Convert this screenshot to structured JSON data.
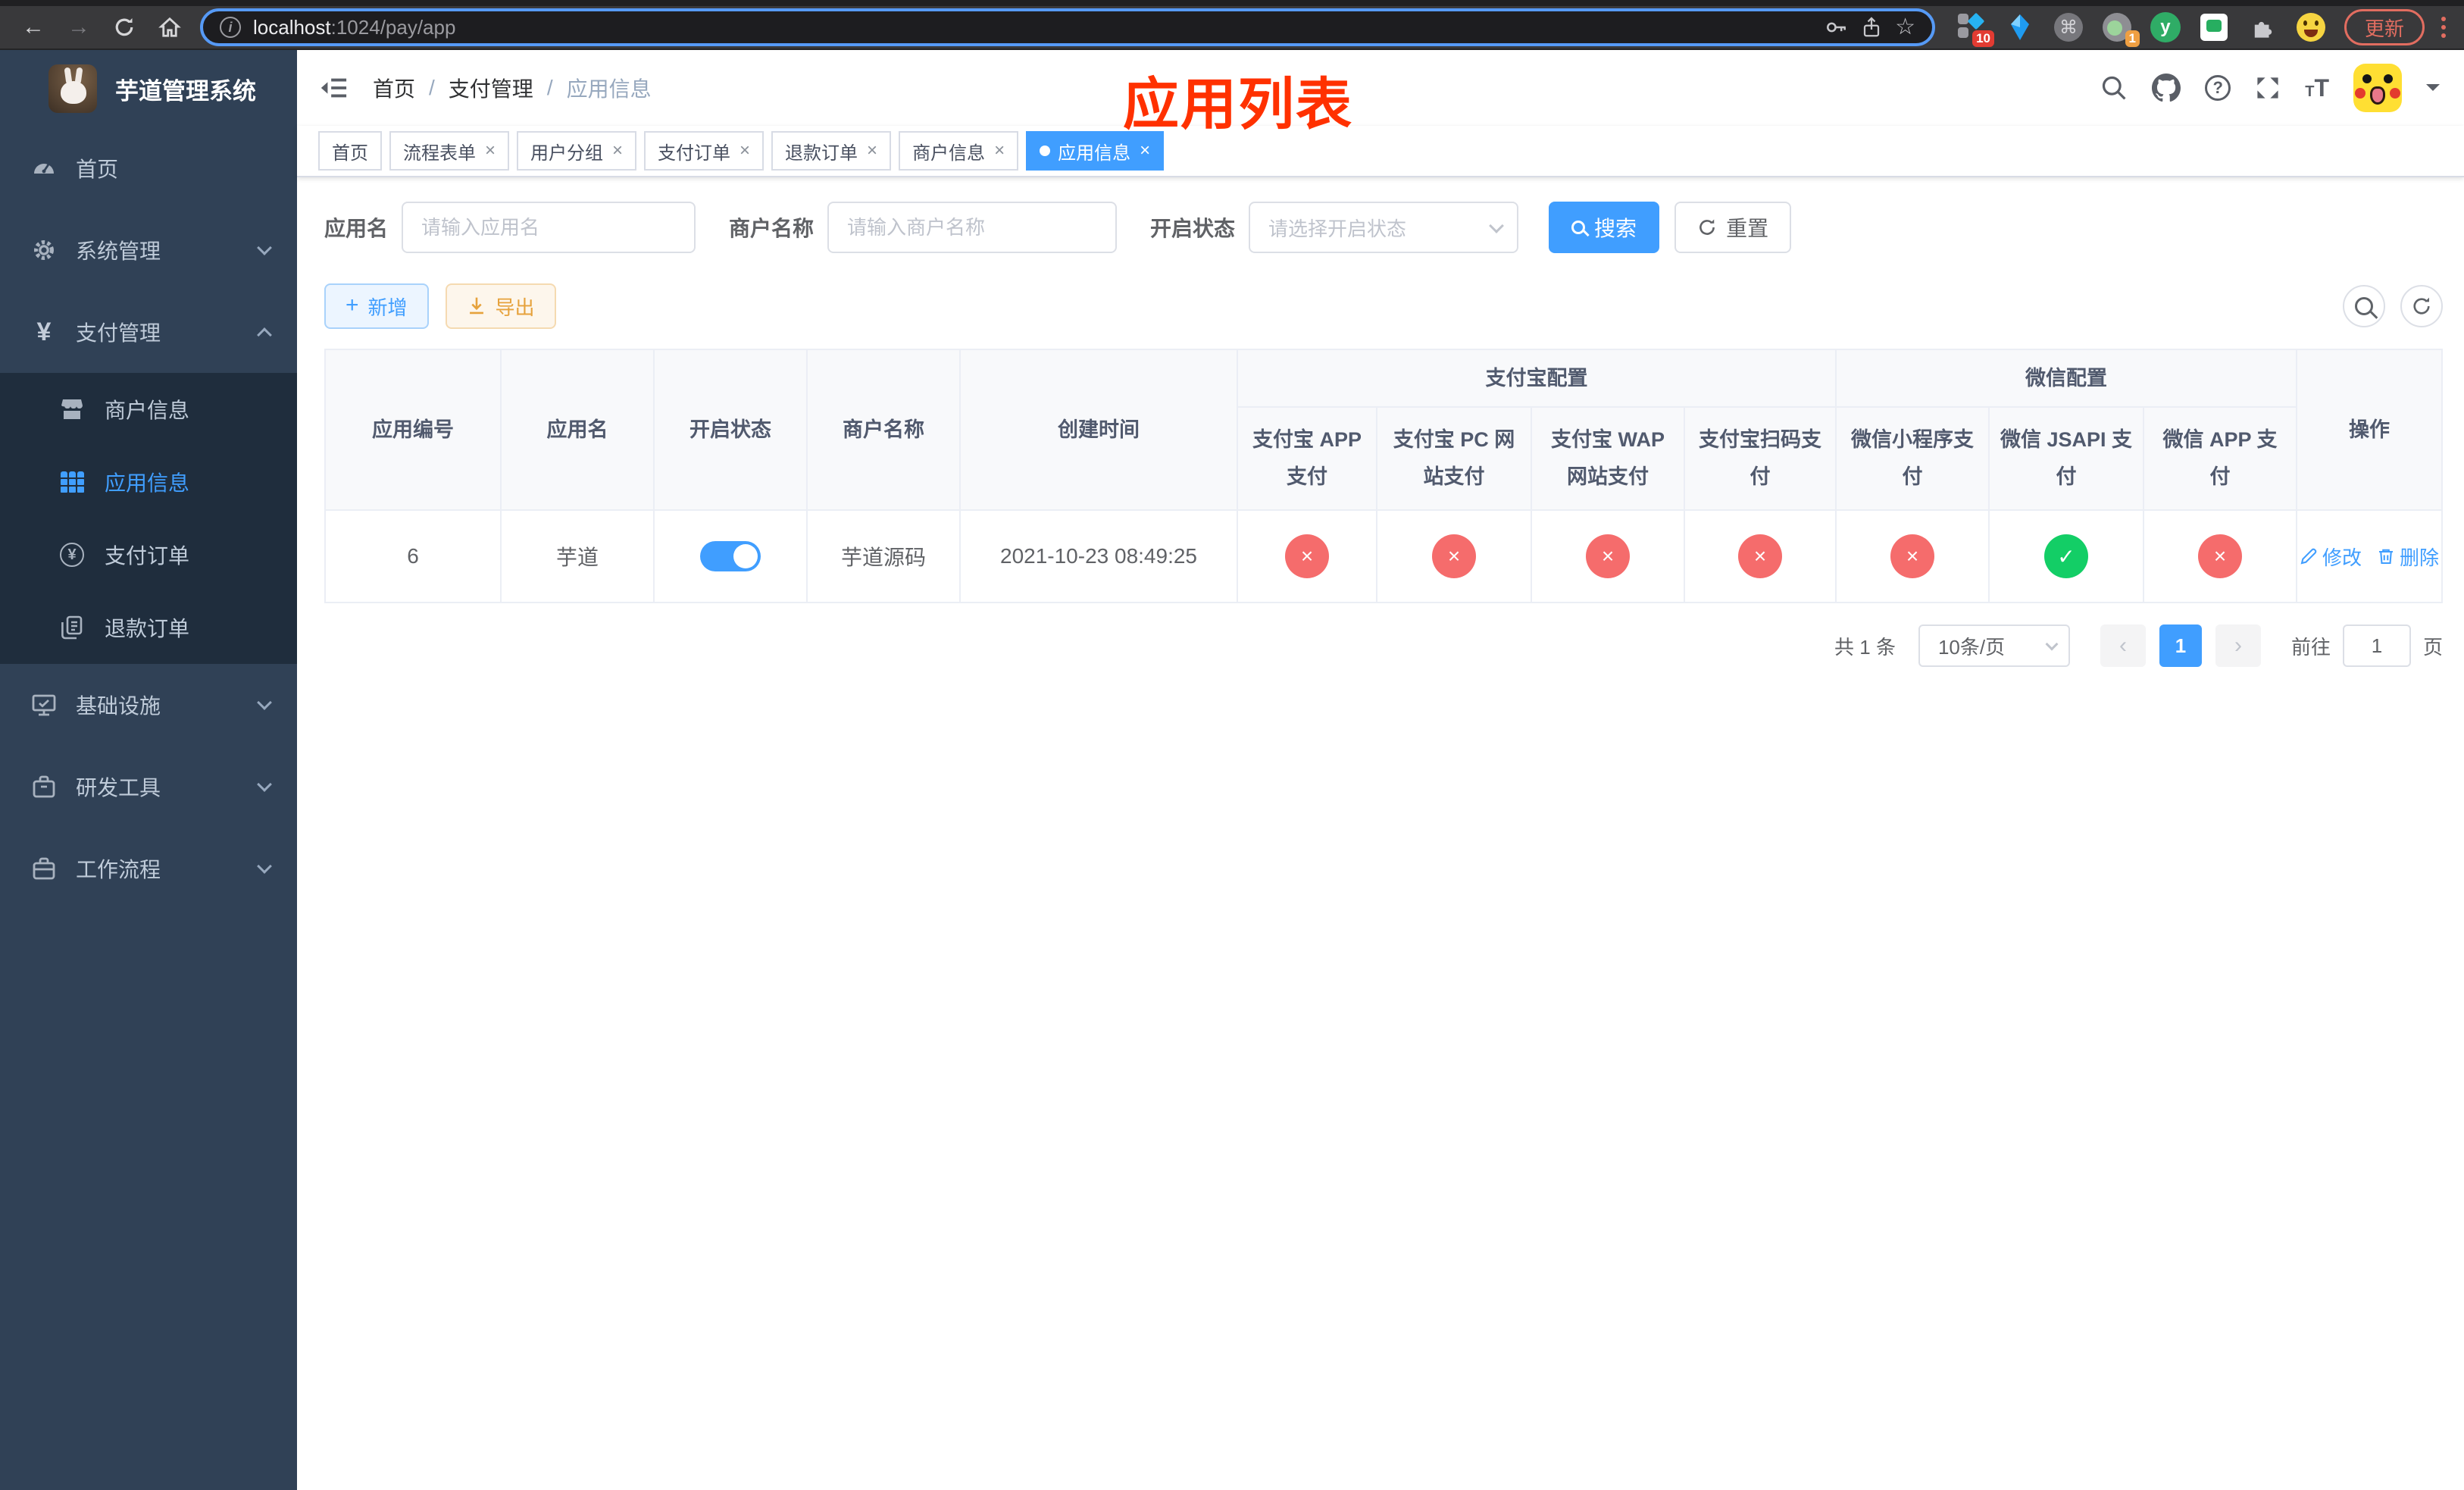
{
  "colors": {
    "accent": "#409EFF",
    "danger": "#F56C6C",
    "success": "#13CE66",
    "warning": "#E6A23C",
    "sidebar_bg": "#304156",
    "submenu_bg": "#1F2D3D",
    "annotation": "#FF3100"
  },
  "browser": {
    "url_host": "localhost",
    "url_rest": ":1024/pay/app",
    "update_label": "更新",
    "ext_blocker_badge": "10",
    "ext_notifier_badge": "1",
    "ext_letter": "y"
  },
  "sidebar": {
    "title": "芋道管理系统",
    "menu": [
      {
        "label": "首页"
      },
      {
        "label": "系统管理"
      },
      {
        "label": "支付管理"
      },
      {
        "label": "商户信息"
      },
      {
        "label": "应用信息"
      },
      {
        "label": "支付订单"
      },
      {
        "label": "退款订单"
      },
      {
        "label": "基础设施"
      },
      {
        "label": "研发工具"
      },
      {
        "label": "工作流程"
      }
    ]
  },
  "breadcrumb": {
    "items": [
      "首页",
      "支付管理",
      "应用信息"
    ]
  },
  "annotation": {
    "text": "应用列表"
  },
  "tabs": [
    {
      "label": "首页"
    },
    {
      "label": "流程表单"
    },
    {
      "label": "用户分组"
    },
    {
      "label": "支付订单"
    },
    {
      "label": "退款订单"
    },
    {
      "label": "商户信息"
    },
    {
      "label": "应用信息"
    }
  ],
  "filters": {
    "app_name_label": "应用名",
    "app_name_placeholder": "请输入应用名",
    "merchant_label": "商户名称",
    "merchant_placeholder": "请输入商户名称",
    "status_label": "开启状态",
    "status_placeholder": "请选择开启状态",
    "search_label": "搜索",
    "reset_label": "重置"
  },
  "toolbar": {
    "add_label": "新增",
    "export_label": "导出"
  },
  "table": {
    "columns": [
      "应用编号",
      "应用名",
      "开启状态",
      "商户名称",
      "创建时间"
    ],
    "groups": [
      "支付宝配置",
      "微信配置"
    ],
    "pay_columns": [
      "支付宝 APP 支付",
      "支付宝 PC 网站支付",
      "支付宝 WAP 网站支付",
      "支付宝扫码支付",
      "微信小程序支付",
      "微信 JSAPI 支付",
      "微信 APP 支付"
    ],
    "actions_header": "操作",
    "row": {
      "id": "6",
      "name": "芋道",
      "enabled": true,
      "merchant": "芋道源码",
      "created": "2021-10-23 08:49:25",
      "pay_status": [
        false,
        false,
        false,
        false,
        false,
        true,
        false
      ]
    },
    "actions": {
      "edit": "修改",
      "delete": "删除"
    }
  },
  "pagination": {
    "total": "共 1 条",
    "page_size": "10条/页",
    "current_page": "1",
    "goto_label": "前往",
    "goto_value": "1",
    "page_unit": "页"
  }
}
